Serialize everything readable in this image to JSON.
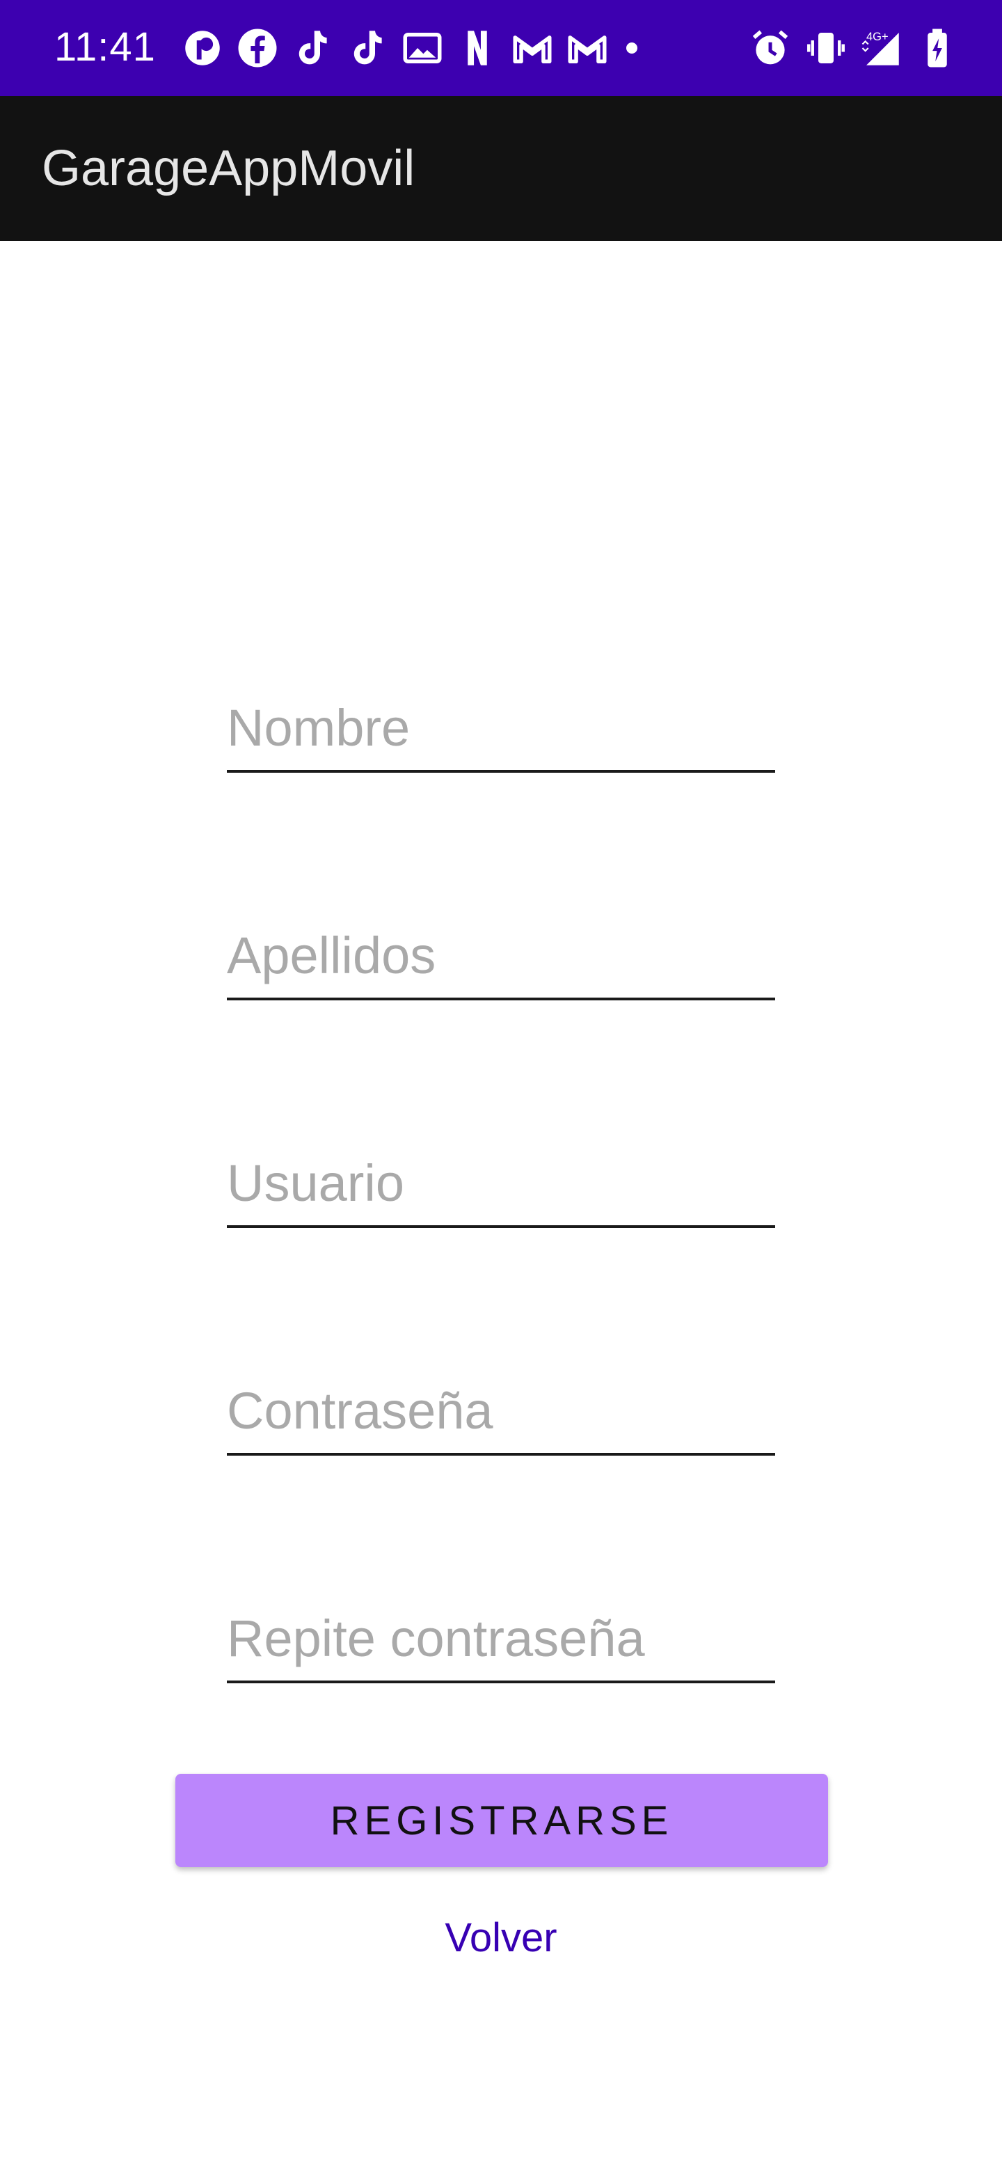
{
  "status_bar": {
    "time": "11:41",
    "network": "4G+",
    "left_icons": [
      "app-icon",
      "facebook-icon",
      "tiktok-icon",
      "tiktok-icon",
      "gallery-icon",
      "netflix-icon",
      "gmail-icon",
      "gmail-icon"
    ],
    "right_icons": [
      "alarm-icon",
      "vibrate-icon",
      "signal-icon",
      "battery-icon"
    ],
    "background": "#3d00b0"
  },
  "app_bar": {
    "title": "GarageAppMovil",
    "background": "#121212"
  },
  "form": {
    "fields": [
      {
        "placeholder": "Nombre",
        "value": ""
      },
      {
        "placeholder": "Apellidos",
        "value": ""
      },
      {
        "placeholder": "Usuario",
        "value": ""
      },
      {
        "placeholder": "Contraseña",
        "value": ""
      },
      {
        "placeholder": "Repite contraseña",
        "value": ""
      }
    ],
    "register_label": "REGISTRARSE",
    "back_label": "Volver",
    "accent": "#bb86fc",
    "link_color": "#3700b3"
  }
}
